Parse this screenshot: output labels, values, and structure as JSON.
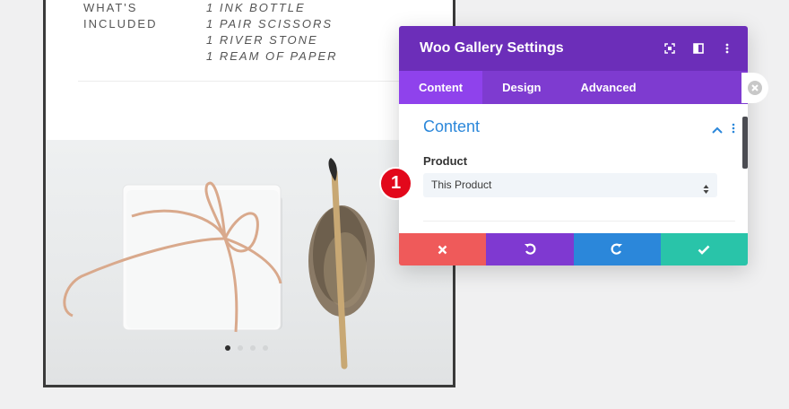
{
  "product": {
    "spec_label": "WHAT'S\nINCLUDED",
    "spec_items": [
      "1 INK BOTTLE",
      "1 PAIR SCISSORS",
      "1 RIVER STONE",
      "1 REAM OF PAPER"
    ],
    "gallery_dots": 4,
    "active_dot": 0
  },
  "modal": {
    "title": "Woo Gallery Settings",
    "header_icons": [
      "fullscreen-icon",
      "split-view-icon",
      "more-vertical-icon"
    ],
    "tabs": [
      "Content",
      "Design",
      "Advanced"
    ],
    "active_tab": "Content",
    "section_title": "Content",
    "field_label": "Product",
    "select_value": "This Product",
    "footer_buttons": [
      {
        "name": "cancel",
        "color": "#ef5a5a"
      },
      {
        "name": "undo",
        "color": "#7f39d1"
      },
      {
        "name": "redo",
        "color": "#2b87da"
      },
      {
        "name": "save",
        "color": "#29c4a9"
      }
    ]
  },
  "callout": {
    "number": "1"
  },
  "colors": {
    "header": "#6c2eb9",
    "tabs": "#7e3bd0",
    "accent": "#2b87da",
    "badge": "#e2081b"
  }
}
